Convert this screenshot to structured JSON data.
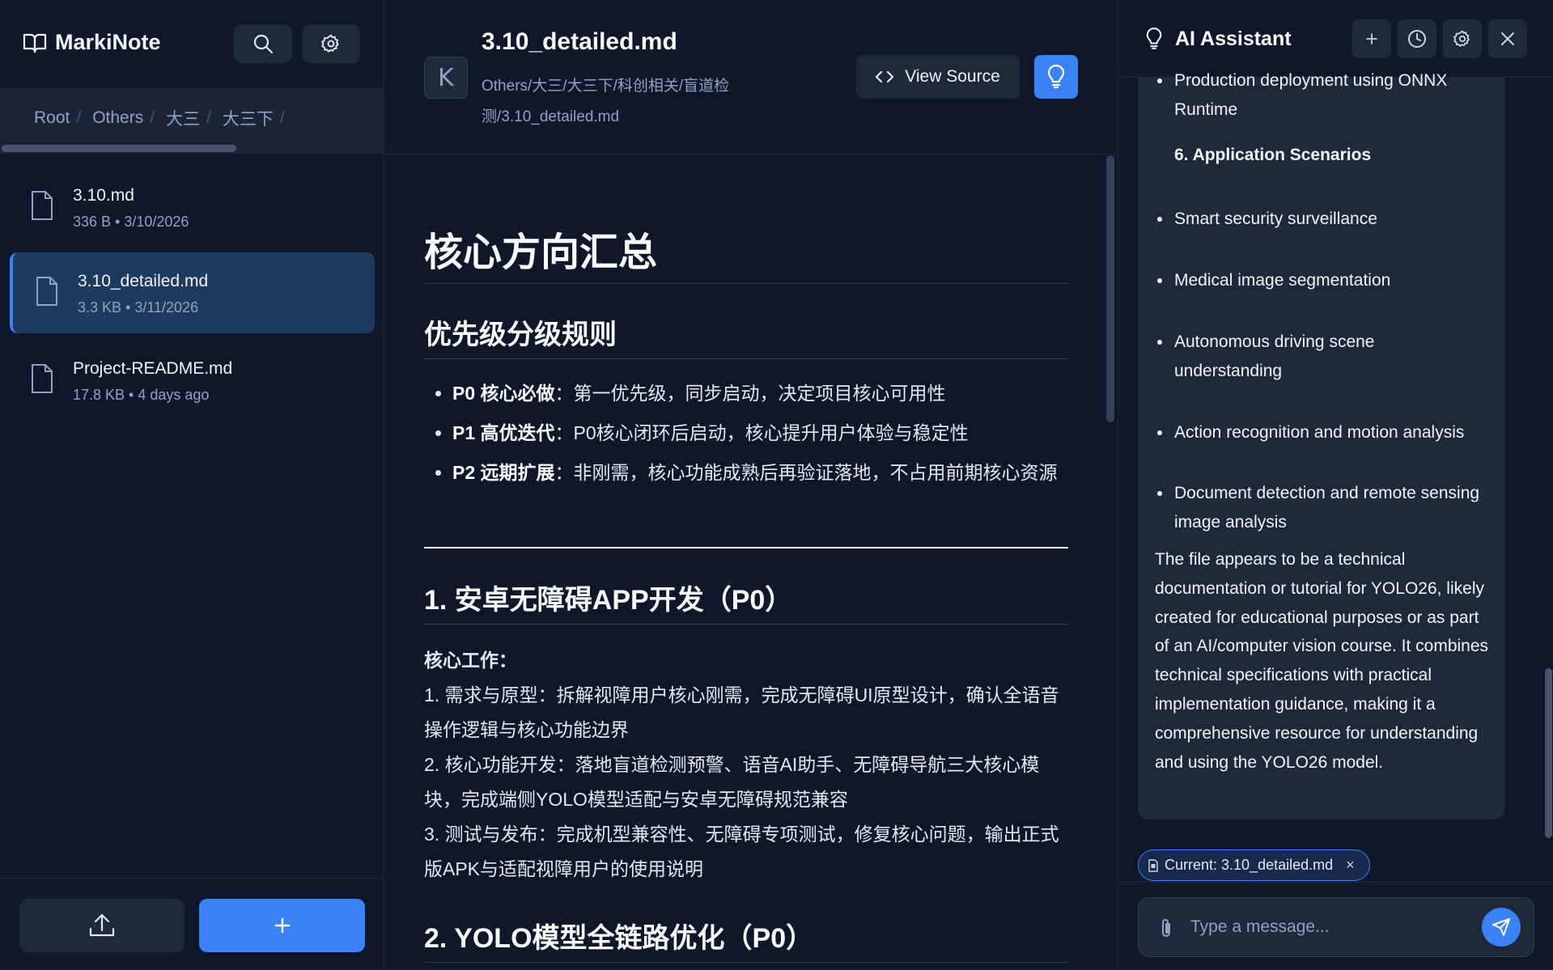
{
  "app": {
    "name": "MarkiNote"
  },
  "colors": {
    "accent": "#3b82f6",
    "background": "#0f172a",
    "panel": "#1e293b"
  },
  "sidebar": {
    "breadcrumb": [
      "Root",
      "Others",
      "大三",
      "大三下"
    ],
    "files": [
      {
        "name": "3.10.md",
        "meta": "336 B • 3/10/2026",
        "active": false
      },
      {
        "name": "3.10_detailed.md",
        "meta": "3.3 KB • 3/11/2026",
        "active": true
      },
      {
        "name": "Project-README.md",
        "meta": "17.8 KB • 4 days ago",
        "active": false
      }
    ],
    "icons": {
      "search": "search-icon",
      "settings": "gear-icon",
      "upload": "upload-icon",
      "new": "plus-icon"
    }
  },
  "document": {
    "avatar_letter": "K",
    "title": "3.10_detailed.md",
    "path": "Others/大三/大三下/科创相关/盲道检测/3.10_detailed.md",
    "view_source_label": "View Source",
    "h1": "核心方向汇总",
    "section1_title": "优先级分级规则",
    "priorities": [
      {
        "label": "P0 核心必做",
        "text": "：第一优先级，同步启动，决定项目核心可用性"
      },
      {
        "label": "P1 高优迭代",
        "text": "：P0核心闭环后启动，核心提升用户体验与稳定性"
      },
      {
        "label": "P2 远期扩展",
        "text": "：非刚需，核心功能成熟后再验证落地，不占用前期核心资源"
      }
    ],
    "section2_title": "1. 安卓无障碍APP开发（P0）",
    "core_work_label": "核心工作",
    "core_work_colon": "：",
    "core_work_items": [
      "1. 需求与原型：拆解视障用户核心刚需，完成无障碍UI原型设计，确认全语音操作逻辑与核心功能边界",
      "2. 核心功能开发：落地盲道检测预警、语音AI助手、无障碍导航三大核心模块，完成端侧YOLO模型适配与安卓无障碍规范兼容",
      "3. 测试与发布：完成机型兼容性、无障碍专项测试，修复核心问题，输出正式版APK与适配视障用户的使用说明"
    ],
    "section3_title": "2. YOLO模型全链路优化（P0）"
  },
  "assistant": {
    "title": "AI Assistant",
    "message": {
      "top_line_1": "Production deployment using ONNX",
      "top_line_2": "Runtime",
      "scenarios_heading": "6. Application Scenarios",
      "scenarios": [
        "Smart security surveillance",
        "Medical image segmentation",
        "Autonomous driving scene understanding",
        "Action recognition and motion analysis",
        "Document detection and remote sensing image analysis"
      ],
      "summary": "The file appears to be a technical documentation or tutorial for YOLO26, likely created for educational purposes or as part of an AI/computer vision course. It combines technical specifications with practical implementation guidance, making it a comprehensive resource for understanding and using the YOLO26 model."
    },
    "context_chip": "Current: 3.10_detailed.md",
    "input_placeholder": "Type a message...",
    "icons": {
      "new_chat": "plus-icon",
      "history": "clock-icon",
      "settings": "gear-icon",
      "close": "close-icon"
    }
  }
}
